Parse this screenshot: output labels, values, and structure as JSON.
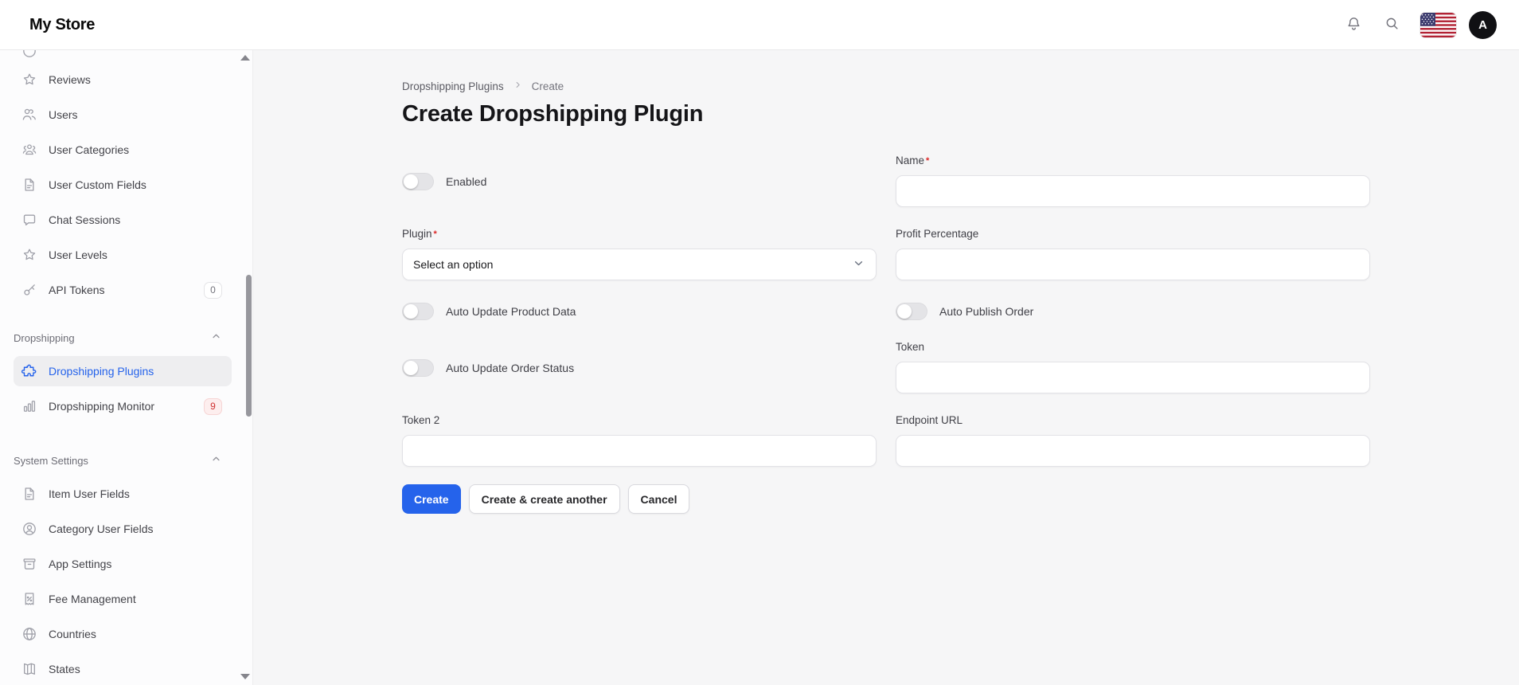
{
  "topbar": {
    "brand": "My Store",
    "avatar_initial": "A"
  },
  "breadcrumb": {
    "items": [
      "Dropshipping Plugins",
      "Create"
    ]
  },
  "page": {
    "title": "Create Dropshipping Plugin"
  },
  "sidebar": {
    "top_items": [
      {
        "label": "Reviews",
        "icon": "star-icon"
      },
      {
        "label": "Users",
        "icon": "users-icon"
      },
      {
        "label": "User Categories",
        "icon": "user-group-icon"
      },
      {
        "label": "User Custom Fields",
        "icon": "document-text-icon"
      },
      {
        "label": "Chat Sessions",
        "icon": "chat-bubble-icon"
      },
      {
        "label": "User Levels",
        "icon": "star-icon"
      },
      {
        "label": "API Tokens",
        "icon": "key-icon",
        "badge": "0",
        "badge_style": "neutral"
      }
    ],
    "groups": [
      {
        "label": "Dropshipping",
        "items": [
          {
            "label": "Dropshipping Plugins",
            "icon": "puzzle-icon",
            "active": true
          },
          {
            "label": "Dropshipping Monitor",
            "icon": "chart-bar-icon",
            "badge": "9",
            "badge_style": "danger"
          }
        ]
      },
      {
        "label": "System Settings",
        "items": [
          {
            "label": "Item User Fields",
            "icon": "document-text-icon"
          },
          {
            "label": "Category User Fields",
            "icon": "user-circle-icon"
          },
          {
            "label": "App Settings",
            "icon": "archive-box-icon"
          },
          {
            "label": "Fee Management",
            "icon": "receipt-percent-icon"
          },
          {
            "label": "Countries",
            "icon": "globe-icon"
          },
          {
            "label": "States",
            "icon": "map-icon"
          }
        ]
      }
    ]
  },
  "form": {
    "enabled": {
      "label": "Enabled",
      "value": false
    },
    "name": {
      "label": "Name",
      "required": true,
      "value": ""
    },
    "plugin": {
      "label": "Plugin",
      "required": true,
      "placeholder": "Select an option"
    },
    "profit_percentage": {
      "label": "Profit Percentage",
      "value": ""
    },
    "auto_update_product_data": {
      "label": "Auto Update Product Data",
      "value": false
    },
    "auto_publish_order": {
      "label": "Auto Publish Order",
      "value": false
    },
    "auto_update_order_status": {
      "label": "Auto Update Order Status",
      "value": false
    },
    "token": {
      "label": "Token",
      "value": ""
    },
    "token_2": {
      "label": "Token 2",
      "value": ""
    },
    "endpoint_url": {
      "label": "Endpoint URL",
      "value": ""
    }
  },
  "actions": {
    "create": "Create",
    "create_and_create_another": "Create & create another",
    "cancel": "Cancel"
  },
  "ui": {
    "required_mark": "*"
  },
  "colors": {
    "primary": "#2563eb",
    "danger": "#dc2626",
    "danger_badge_bg": "#fdeeee",
    "active_item_bg": "#eeeef0"
  }
}
